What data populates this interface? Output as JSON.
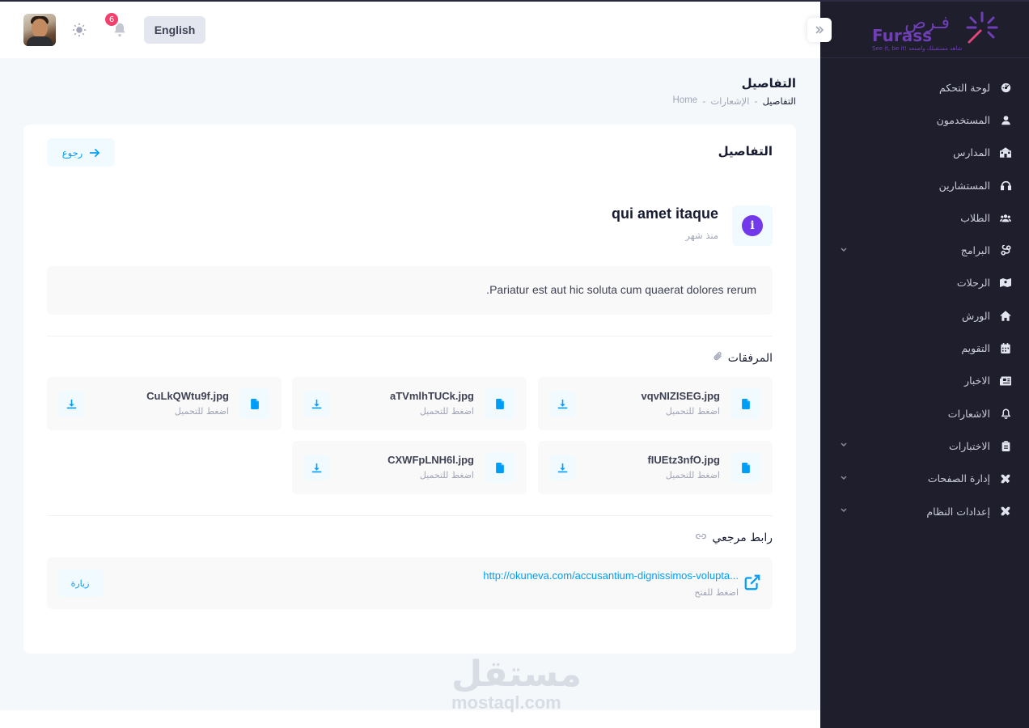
{
  "header": {
    "notification_count": "6",
    "language_button": "English"
  },
  "sidebar": {
    "logo_ar": "فـرص",
    "logo_en": "Furass",
    "logo_tagline": "See it, be it! شاهد مستقبلك واصنعه",
    "items": [
      {
        "label": "لوحة التحكم",
        "icon": "dashboard-icon",
        "has_submenu": false
      },
      {
        "label": "المستخدمون",
        "icon": "user-icon",
        "has_submenu": false
      },
      {
        "label": "المدارس",
        "icon": "school-icon",
        "has_submenu": false
      },
      {
        "label": "المستشارين",
        "icon": "headset-icon",
        "has_submenu": false
      },
      {
        "label": "الطلاب",
        "icon": "users-icon",
        "has_submenu": false
      },
      {
        "label": "البرامج",
        "icon": "programs-icon",
        "has_submenu": true
      },
      {
        "label": "الرحلات",
        "icon": "map-icon",
        "has_submenu": false
      },
      {
        "label": "الورش",
        "icon": "home-icon",
        "has_submenu": false
      },
      {
        "label": "التقويم",
        "icon": "calendar-icon",
        "has_submenu": false
      },
      {
        "label": "الاخبار",
        "icon": "newspaper-icon",
        "has_submenu": false
      },
      {
        "label": "الاشعارات",
        "icon": "bell-icon",
        "has_submenu": false
      },
      {
        "label": "الاختبارات",
        "icon": "clipboard-icon",
        "has_submenu": true
      },
      {
        "label": "إدارة الصفحات",
        "icon": "tools-icon",
        "has_submenu": true
      },
      {
        "label": "إعدادات النظام",
        "icon": "tools-icon",
        "has_submenu": true
      }
    ]
  },
  "page": {
    "title": "التفاصيل",
    "breadcrumb": {
      "home": "Home",
      "middle": "الإشعارات",
      "current": "التفاصيل"
    }
  },
  "card": {
    "title": "التفاصيل",
    "back_label": "رجوع",
    "notification": {
      "title": "qui amet itaque",
      "time": "منذ شهر",
      "body": "Pariatur est aut hic soluta cum quaerat dolores rerum."
    },
    "attachments": {
      "heading": "المرفقات",
      "files": [
        {
          "name": "vqvNIZISEG.jpg",
          "hint": "اضغط للتحميل"
        },
        {
          "name": "aTVmlhTUCk.jpg",
          "hint": "اضغط للتحميل"
        },
        {
          "name": "CuLkQWtu9f.jpg",
          "hint": "اضغط للتحميل"
        },
        {
          "name": "fIUEtz3nfO.jpg",
          "hint": "اضغط للتحميل"
        },
        {
          "name": "CXWFpLNH6l.jpg",
          "hint": "اضغط للتحميل"
        }
      ]
    },
    "reference": {
      "heading": "رابط مرجعي",
      "url": "http://okuneva.com/accusantium-dignissimos-volupta...",
      "hint": "اضغط للفتح",
      "visit_label": "زيارة"
    }
  },
  "watermark": {
    "ar": "مستقل",
    "en": "mostaql.com"
  }
}
